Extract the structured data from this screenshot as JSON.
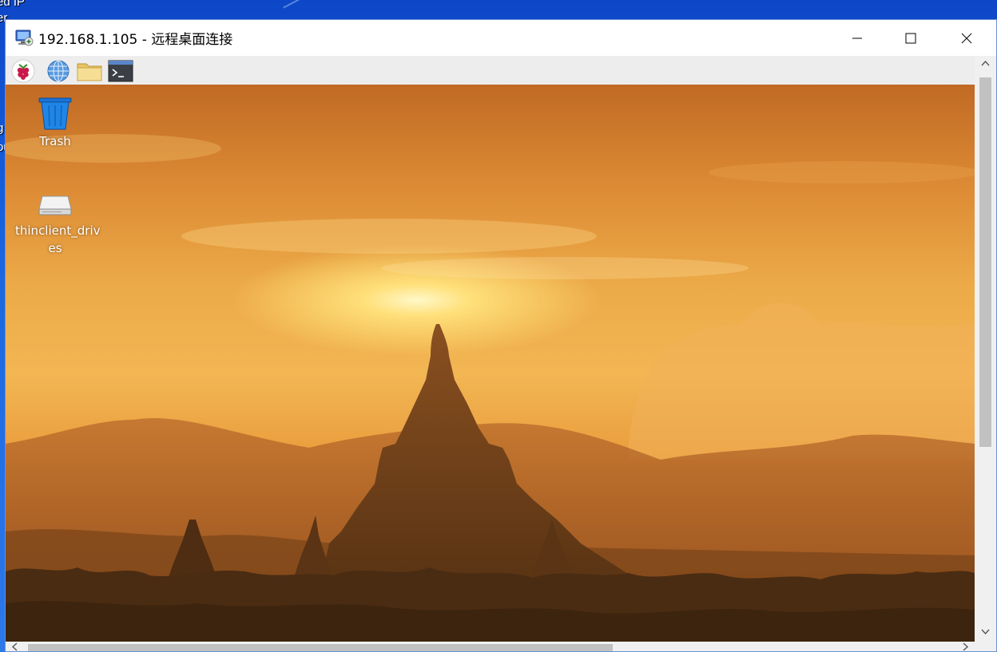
{
  "host": {
    "labels": [
      "ed IP",
      "er",
      "g",
      "ou"
    ]
  },
  "window": {
    "title": "192.168.1.105 - 远程桌面连接",
    "controls": {
      "minimize": "minimize-icon",
      "maximize": "maximize-icon",
      "close": "close-icon"
    }
  },
  "panel": {
    "launchers": [
      "raspberry-menu-icon",
      "web-browser-icon",
      "file-manager-icon",
      "terminal-icon"
    ]
  },
  "desktop": {
    "icons": [
      {
        "label": "Trash",
        "icon": "trash-icon"
      },
      {
        "label": "thinclient_driv",
        "label2": "es",
        "icon": "drive-icon"
      }
    ]
  },
  "colors": {
    "sky_top": "#c06a24",
    "sky_glow": "#ffe07a",
    "silhouette": "#5a3414",
    "panel_bg": "#ededed",
    "host_bg": "#1a66e0"
  }
}
